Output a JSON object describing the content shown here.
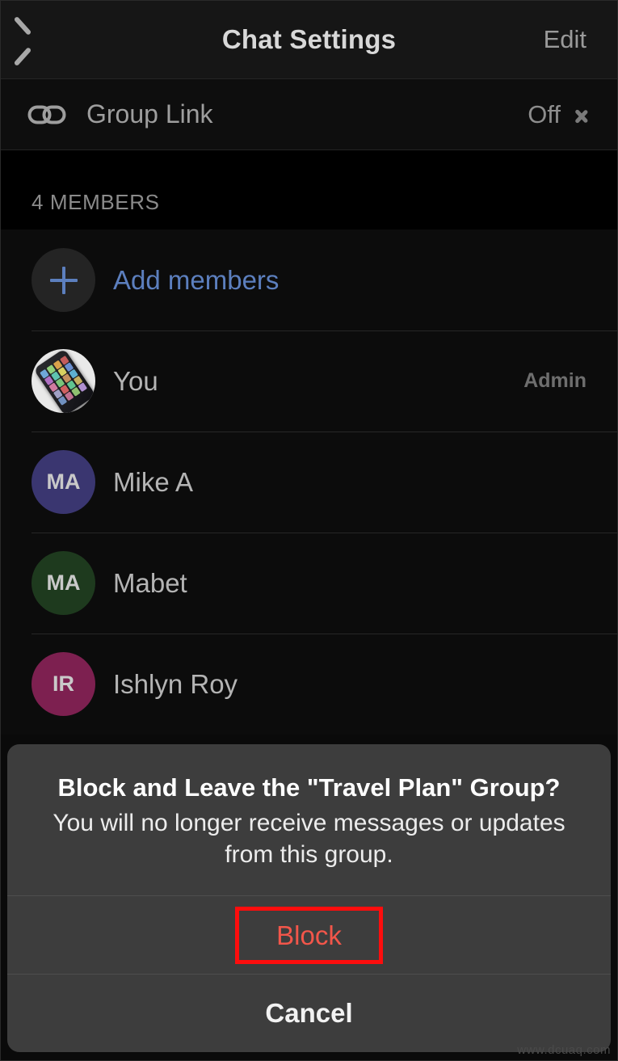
{
  "navbar": {
    "back_icon": "chevron-left-icon",
    "title": "Chat Settings",
    "edit_label": "Edit"
  },
  "group_link": {
    "icon": "link-icon",
    "label": "Group Link",
    "value": "Off",
    "disclosure_icon": "chevron-right-icon"
  },
  "members_section": {
    "header": "4 MEMBERS",
    "add": {
      "icon": "plus-icon",
      "label": "Add members"
    },
    "rows": [
      {
        "initials": "",
        "name": "You",
        "role": "Admin",
        "avatar_type": "photo",
        "avatar_color": "#e9e9e9"
      },
      {
        "initials": "MA",
        "name": "Mike A",
        "role": "",
        "avatar_type": "initials",
        "avatar_color": "#3a3670"
      },
      {
        "initials": "MA",
        "name": "Mabet",
        "role": "",
        "avatar_type": "initials",
        "avatar_color": "#1e3a1e"
      },
      {
        "initials": "IR",
        "name": "Ishlyn Roy",
        "role": "",
        "avatar_type": "initials",
        "avatar_color": "#7d2050"
      }
    ]
  },
  "action_sheet": {
    "title": "Block and Leave the \"Travel Plan\" Group?",
    "message": "You will no longer receive messages or updates from this group.",
    "block_label": "Block",
    "cancel_label": "Cancel"
  },
  "colors": {
    "accent_blue": "#5c7fbe",
    "destructive_red": "#f2564a",
    "highlight_red": "#fd0d0d",
    "sheet_bg": "#3d3d3d"
  },
  "watermark": "www.dcuaq.com"
}
